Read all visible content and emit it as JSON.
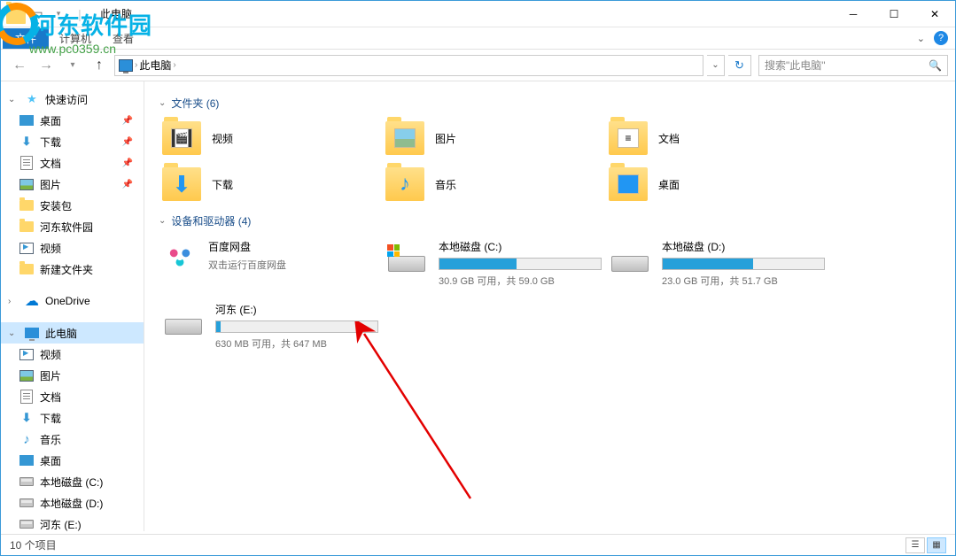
{
  "watermark": {
    "text": "河东软件园",
    "url": "www.pc0359.cn"
  },
  "window": {
    "title": "此电脑"
  },
  "ribbon": {
    "file": "文件",
    "computer": "计算机",
    "view": "查看"
  },
  "breadcrumb": {
    "location": "此电脑"
  },
  "search": {
    "placeholder": "搜索\"此电脑\""
  },
  "nav": {
    "quick_access": "快速访问",
    "quick_items": [
      {
        "label": "桌面",
        "icon": "desktop",
        "pinned": true
      },
      {
        "label": "下载",
        "icon": "dl",
        "pinned": true
      },
      {
        "label": "文档",
        "icon": "doc",
        "pinned": true
      },
      {
        "label": "图片",
        "icon": "pic",
        "pinned": true
      },
      {
        "label": "安装包",
        "icon": "folder",
        "pinned": false
      },
      {
        "label": "河东软件园",
        "icon": "folder",
        "pinned": false
      },
      {
        "label": "视频",
        "icon": "video",
        "pinned": false
      },
      {
        "label": "新建文件夹",
        "icon": "folder",
        "pinned": false
      }
    ],
    "onedrive": "OneDrive",
    "this_pc": "此电脑",
    "pc_items": [
      {
        "label": "视频",
        "icon": "video"
      },
      {
        "label": "图片",
        "icon": "pic"
      },
      {
        "label": "文档",
        "icon": "doc"
      },
      {
        "label": "下载",
        "icon": "dl"
      },
      {
        "label": "音乐",
        "icon": "music"
      },
      {
        "label": "桌面",
        "icon": "desktop"
      },
      {
        "label": "本地磁盘 (C:)",
        "icon": "drive"
      },
      {
        "label": "本地磁盘 (D:)",
        "icon": "drive"
      },
      {
        "label": "河东 (E:)",
        "icon": "drive"
      }
    ]
  },
  "content": {
    "folders_header": "文件夹 (6)",
    "folders": [
      {
        "label": "视频",
        "kind": "vid"
      },
      {
        "label": "图片",
        "kind": "pic"
      },
      {
        "label": "文档",
        "kind": "doc"
      },
      {
        "label": "下载",
        "kind": "dl"
      },
      {
        "label": "音乐",
        "kind": "mus"
      },
      {
        "label": "桌面",
        "kind": "desk"
      }
    ],
    "devices_header": "设备和驱动器 (4)",
    "baidu": {
      "name": "百度网盘",
      "sub": "双击运行百度网盘"
    },
    "drives": [
      {
        "name": "本地磁盘 (C:)",
        "sub": "30.9 GB 可用，共 59.0 GB",
        "pct": 48,
        "win": true
      },
      {
        "name": "本地磁盘 (D:)",
        "sub": "23.0 GB 可用，共 51.7 GB",
        "pct": 56,
        "win": false
      },
      {
        "name": "河东 (E:)",
        "sub": "630 MB 可用，共 647 MB",
        "pct": 3,
        "win": false
      }
    ]
  },
  "status": {
    "text": "10 个项目"
  }
}
